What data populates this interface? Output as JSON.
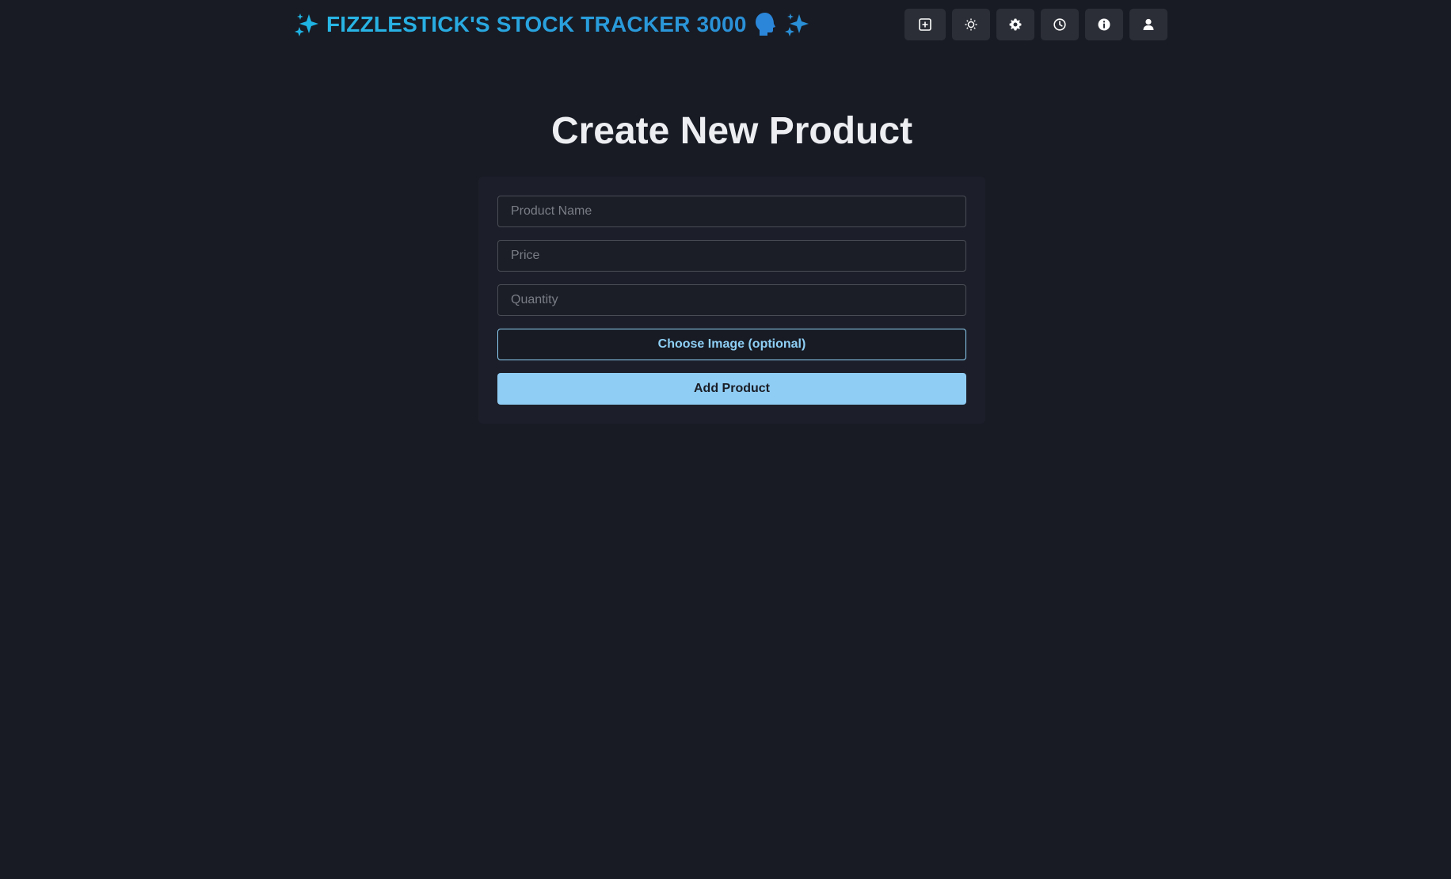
{
  "header": {
    "brand_title": "FIZZLESTICK'S STOCK TRACKER 3000",
    "brand_gradient": [
      "#28b7e6",
      "#2a8fd6"
    ],
    "leading_icon": "sparkles-icon",
    "trailing_icons": [
      "speaking-head-icon",
      "sparkles-icon"
    ],
    "nav_buttons": [
      {
        "icon": "plus-square-icon"
      },
      {
        "icon": "sun-icon"
      },
      {
        "icon": "gear-icon"
      },
      {
        "icon": "clock-icon"
      },
      {
        "icon": "info-icon"
      },
      {
        "icon": "user-icon"
      }
    ]
  },
  "main": {
    "title": "Create New Product",
    "form": {
      "product_name": {
        "placeholder": "Product Name",
        "value": ""
      },
      "price": {
        "placeholder": "Price",
        "value": ""
      },
      "quantity": {
        "placeholder": "Quantity",
        "value": ""
      },
      "choose_image_label": "Choose Image (optional)",
      "submit_label": "Add Product"
    }
  },
  "colors": {
    "background": "#181b24",
    "card": "#1c1f29",
    "accent": "#90cdf4",
    "nav_button": "#2b2e36"
  }
}
